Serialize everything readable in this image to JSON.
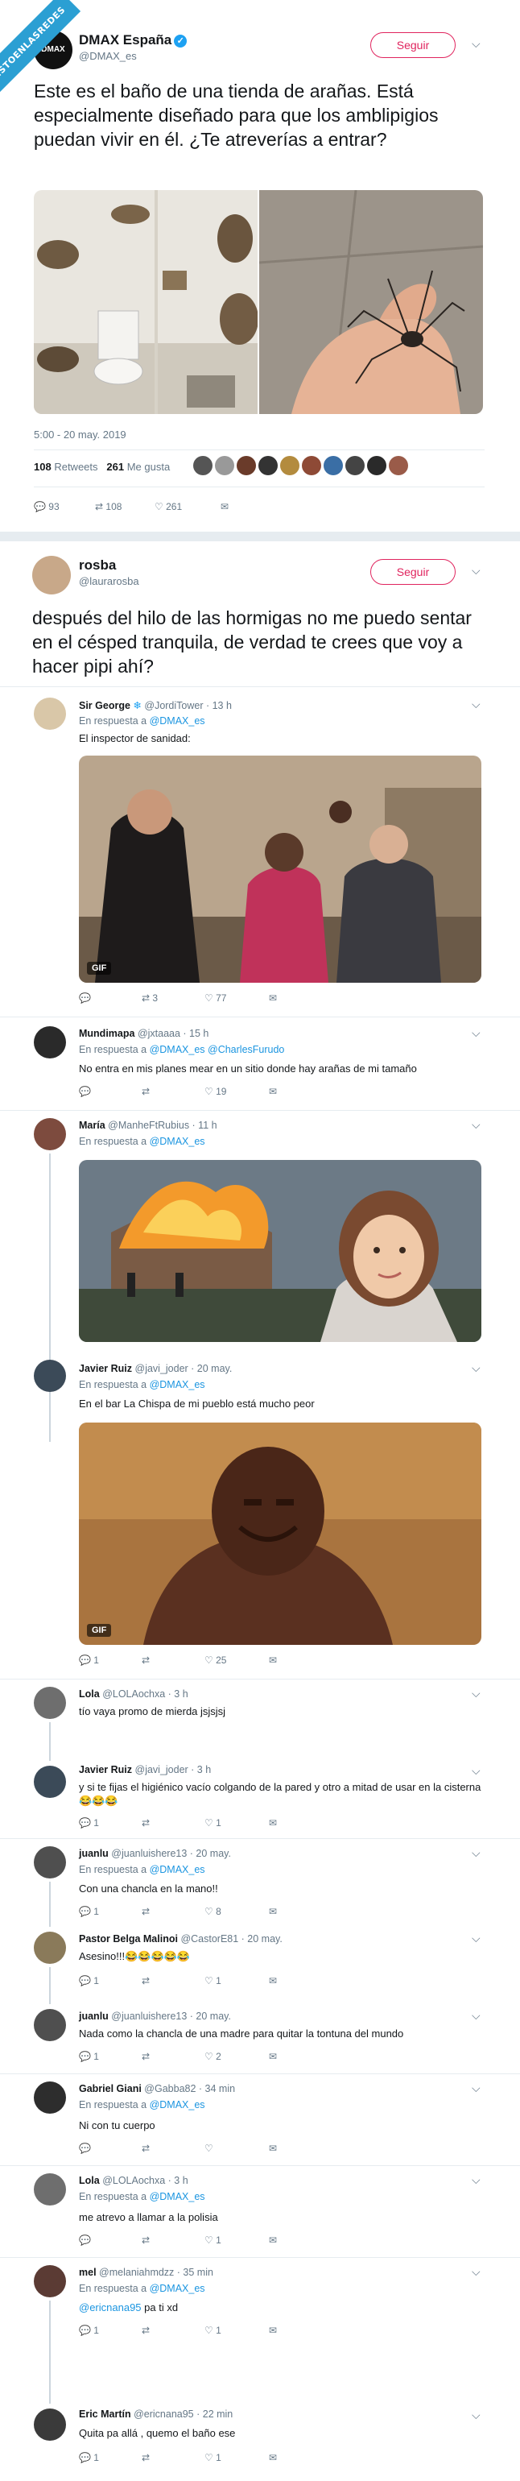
{
  "watermark": "VISTOENLASREDES",
  "tweet1": {
    "name": "DMAX España",
    "handle": "@DMAX_es",
    "avatar_text": "DMAX",
    "follow": "Seguir",
    "text": "Este es el baño de una tienda de arañas. Está especialmente diseñado para que los amblipigios puedan vivir en él. ¿Te atreverías a entrar?",
    "timestamp": "5:00 - 20 may. 2019",
    "retweets_count": "108",
    "retweets_label": "Retweets",
    "likes_count": "261",
    "likes_label": "Me gusta",
    "actions": {
      "reply": "93",
      "retweet": "108",
      "like": "261"
    }
  },
  "tweet2": {
    "name": "rosba",
    "handle": "@laurarosba",
    "follow": "Seguir",
    "text": "después del hilo de las hormigas no me puedo sentar en el césped tranquila, de verdad te crees que voy a hacer pipi ahí?"
  },
  "replies": [
    {
      "name": "Sir George",
      "handle": "@JordiTower · 13 h",
      "reply_prefix": "En respuesta a",
      "reply_to": "@DMAX_es",
      "text": "El inspector de sanidad:",
      "gif": "GIF",
      "actions": {
        "reply": "",
        "retweet": "3",
        "like": "77"
      }
    },
    {
      "name": "Mundimapa",
      "handle": "@jxtaaaa · 15 h",
      "reply_prefix": "En respuesta a",
      "reply_to": "@DMAX_es @CharlesFurudo",
      "text": "No entra en mis planes mear en un sitio donde hay arañas de mi tamaño",
      "actions": {
        "reply": "",
        "retweet": "",
        "like": "19"
      }
    },
    {
      "name": "María",
      "handle": "@ManheFtRubius · 11 h",
      "reply_prefix": "En respuesta a",
      "reply_to": "@DMAX_es",
      "text": ""
    },
    {
      "name": "Javier Ruiz",
      "handle": "@javi_joder · 20 may.",
      "reply_prefix": "En respuesta a",
      "reply_to": "@DMAX_es",
      "text": "En el bar La Chispa de mi pueblo está mucho  peor",
      "gif": "GIF",
      "actions": {
        "reply": "1",
        "retweet": "",
        "like": "25"
      }
    },
    {
      "name": "Lola",
      "handle": "@LOLAochxa · 3 h",
      "text": "tío vaya promo de mierda jsjsjsj"
    },
    {
      "name": "Javier Ruiz",
      "handle": "@javi_joder · 3 h",
      "text": "y si te fijas el higiénico vacío colgando de la pared y otro a mitad de usar en la cisterna😂😂😂",
      "actions": {
        "reply": "1",
        "retweet": "",
        "like": "1"
      }
    },
    {
      "name": "juanlu",
      "handle": "@juanluishere13 · 20 may.",
      "reply_prefix": "En respuesta a",
      "reply_to": "@DMAX_es",
      "text": "Con una chancla en la mano!!",
      "actions": {
        "reply": "1",
        "retweet": "",
        "like": "8"
      }
    },
    {
      "name": "Pastor Belga Malinoi",
      "handle": "@CastorE81 · 20 may.",
      "text": "Asesino!!!😂😂😂😂😂",
      "actions": {
        "reply": "1",
        "retweet": "",
        "like": "1"
      }
    },
    {
      "name": "juanlu",
      "handle": "@juanluishere13 · 20 may.",
      "text": "Nada como la chancla de una madre para quitar la tontuna del mundo",
      "actions": {
        "reply": "1",
        "retweet": "",
        "like": "2"
      }
    },
    {
      "name": "Gabriel Giani",
      "handle": "@Gabba82 · 34 min",
      "reply_prefix": "En respuesta a",
      "reply_to": "@DMAX_es",
      "text": "Ni con tu cuerpo",
      "actions": {
        "reply": "",
        "retweet": "",
        "like": ""
      }
    },
    {
      "name": "Lola",
      "handle": "@LOLAochxa · 3 h",
      "reply_prefix": "En respuesta a",
      "reply_to": "@DMAX_es",
      "text": "me atrevo a llamar a la polisia",
      "actions": {
        "reply": "",
        "retweet": "",
        "like": "1"
      }
    },
    {
      "name": "mel",
      "handle": "@melaniahmdzz · 35 min",
      "reply_prefix": "En respuesta a",
      "reply_to": "@DMAX_es",
      "text_mention": "@ericnana95",
      "text": " pa ti xd",
      "actions": {
        "reply": "1",
        "retweet": "",
        "like": "1"
      }
    },
    {
      "name": "Eric Martín",
      "handle": "@ericnana95 · 22 min",
      "text": "Quita pa allá , quemo el baño ese",
      "actions": {
        "reply": "1",
        "retweet": "",
        "like": "1"
      }
    }
  ],
  "colors": {
    "link": "#1b95e0",
    "follow": "#e0245e",
    "muted": "#657786",
    "verified": "#1da1f2"
  }
}
